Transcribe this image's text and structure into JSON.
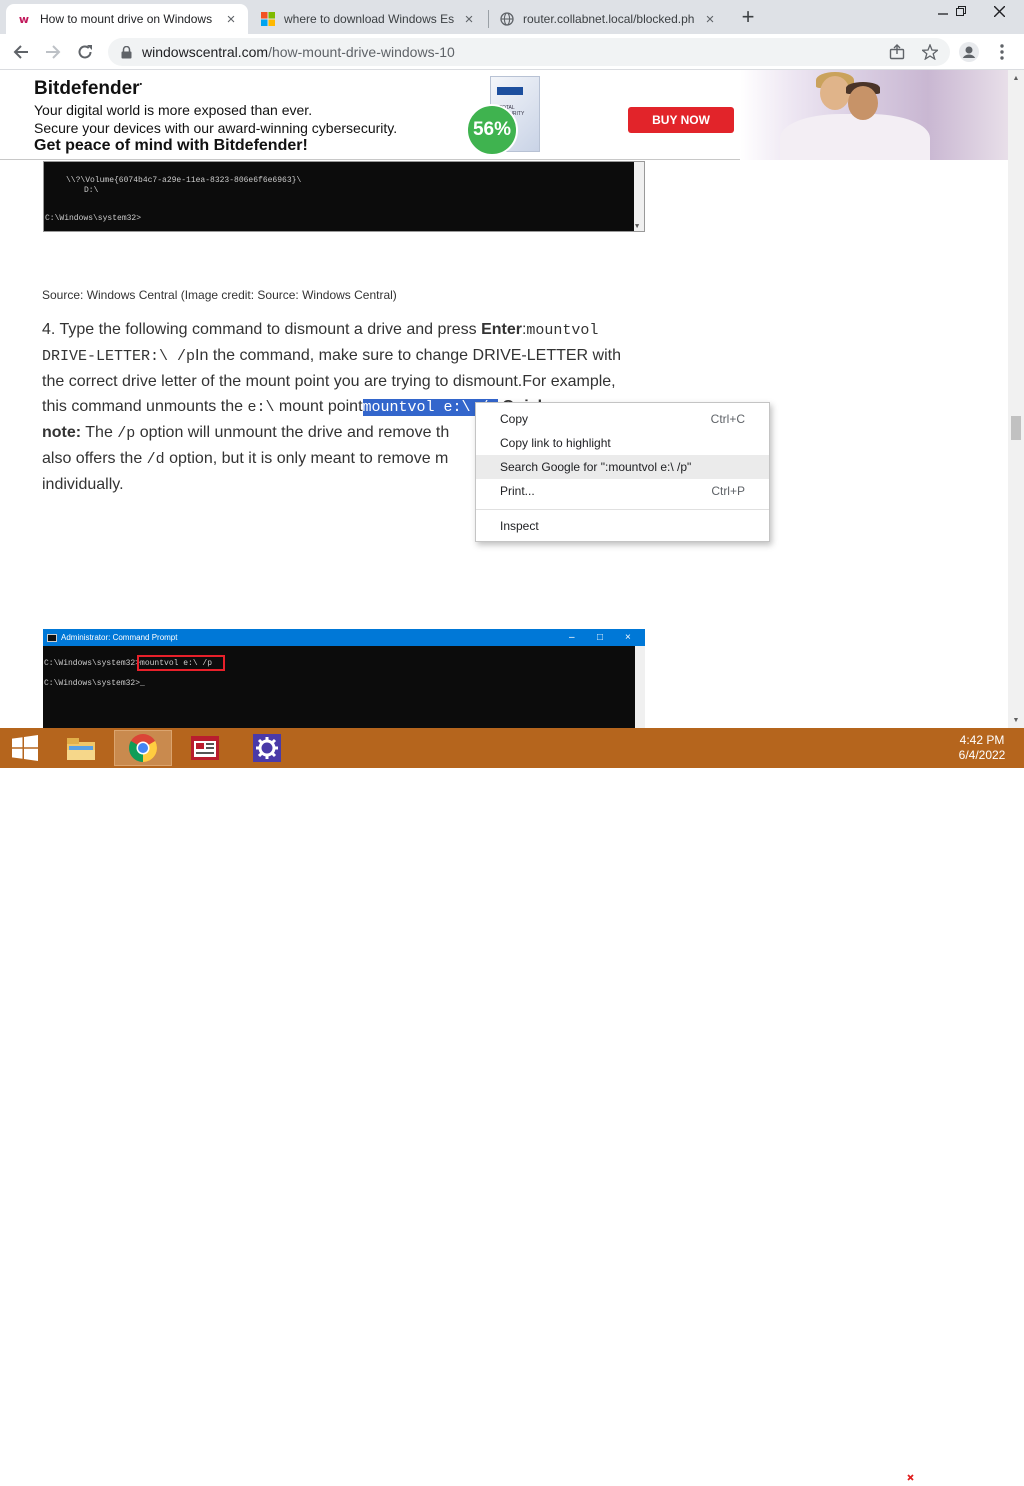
{
  "browser": {
    "tabs": [
      {
        "title": "How to mount drive on Windows",
        "active": true
      },
      {
        "title": "where to download Windows Ess",
        "active": false
      },
      {
        "title": "router.collabnet.local/blocked.ph",
        "active": false
      }
    ],
    "url_domain": "windowscentral.com",
    "url_path": "/how-mount-drive-windows-10"
  },
  "ad": {
    "brand": "Bitdefender",
    "line1": "Your digital world is more exposed than ever.",
    "line2": "Secure your devices with our award-winning cybersecurity.",
    "line3": "Get peace of mind with Bitdefender!",
    "badge": "56%",
    "cta": "BUY NOW"
  },
  "cmd1": {
    "line1": "\\\\?\\Volume{6074b4c7-a29e-11ea-8323-806e6f6e6963}\\",
    "line2": "D:\\",
    "line3": "C:\\Windows\\system32>"
  },
  "article": {
    "credit": "Source: Windows Central (Image credit: Source: Windows Central)",
    "step_intro": "4. Type the following command to dismount a drive and press ",
    "enter_label": "Enter",
    "colon": ":",
    "code_mountvol": "mountvol",
    "code_drive_letter": "DRIVE-LETTER:\\ /p",
    "after_code": "In the command, make sure to change DRIVE-LETTER with the correct drive letter of the mount point you are trying to dismount.For example, this command unmounts the ",
    "code_e": "e:\\",
    "mid_text": " mount point",
    "highlight": "mountvol e:\\ /p",
    "quick_label": "Quick",
    "note_label": "note:",
    "note_part1": " The ",
    "code_p": "/p",
    "note_part2": " option will unmount the drive and remove th",
    "line_also": "also offers the ",
    "code_d": "/d",
    "line_also2": " option, but it is only meant to remove m",
    "line_last": "individually."
  },
  "cmd2": {
    "title": "Administrator: Command Prompt",
    "line1_prompt": "C:\\Windows\\system32>",
    "line1_cmd": "mountvol e:\\ /p",
    "line2": "C:\\Windows\\system32>"
  },
  "context_menu": {
    "copy": "Copy",
    "copy_shortcut": "Ctrl+C",
    "copy_link": "Copy link to highlight",
    "search": "Search Google for \":mountvol e:\\ /p\"",
    "print": "Print...",
    "print_shortcut": "Ctrl+P",
    "inspect": "Inspect"
  },
  "taskbar": {
    "time": "4:42 PM",
    "date": "6/4/2022"
  },
  "colors": {
    "taskbar": "#b5651d",
    "selection": "#3366cc",
    "buy_button": "#e2242a",
    "badge": "#3fb34f"
  }
}
